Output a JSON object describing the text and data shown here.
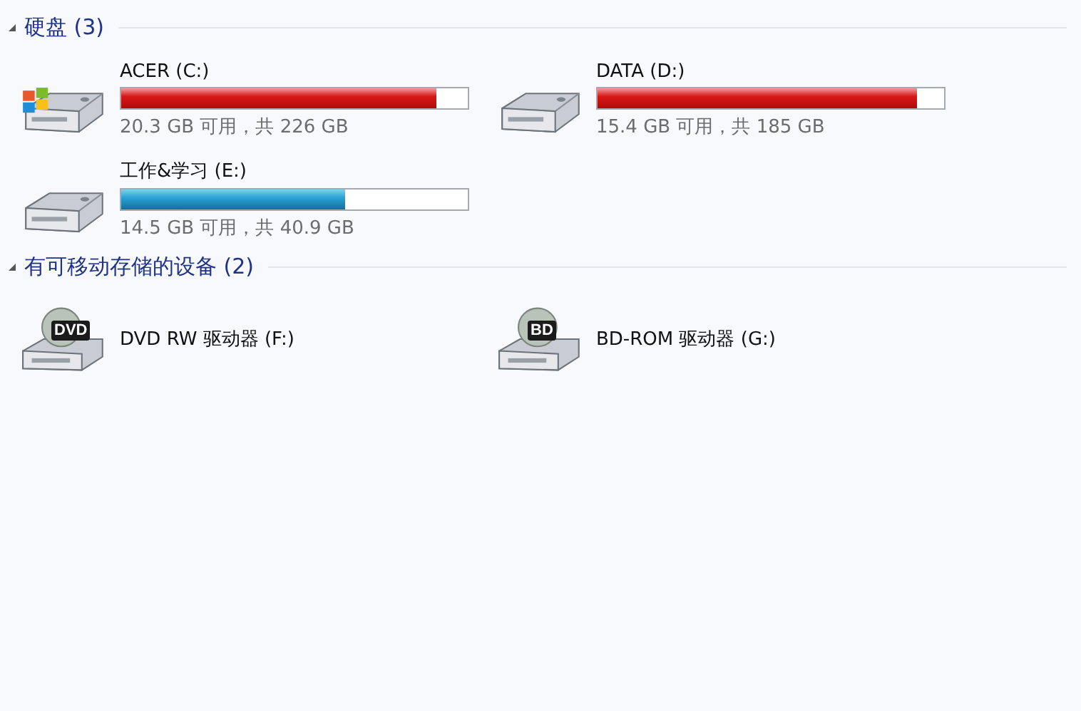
{
  "groups": [
    {
      "title": "硬盘 (3)",
      "expanded": true,
      "items": [
        {
          "kind": "system-disk",
          "name": "ACER (C:)",
          "level": 0.91,
          "info": "20.3 GB 可用，共 226 GB"
        },
        {
          "kind": "disk",
          "name": "DATA (D:)",
          "level": 0.92,
          "info": "15.4 GB 可用，共 185 GB"
        },
        {
          "kind": "disk",
          "name": "工作&学习 (E:)",
          "level": 0.645,
          "info": "14.5 GB 可用，共 40.9 GB"
        }
      ]
    },
    {
      "title": "有可移动存储的设备 (2)",
      "expanded": true,
      "items": [
        {
          "kind": "optical",
          "badge": "DVD",
          "name": "DVD RW 驱动器 (F:)"
        },
        {
          "kind": "optical",
          "badge": "BD",
          "name": "BD-ROM 驱动器 (G:)"
        }
      ]
    }
  ]
}
